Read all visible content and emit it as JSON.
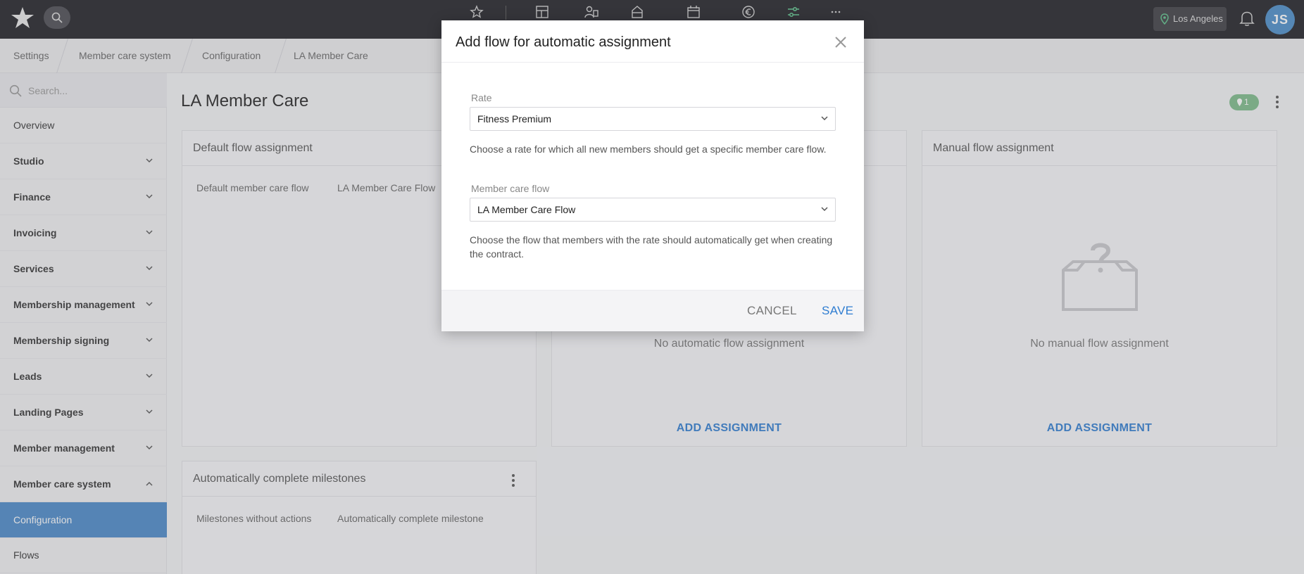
{
  "topbar": {
    "location": "Los Angeles",
    "avatar_initials": "JS",
    "nav_icons": [
      "star-icon",
      "dashboard-icon",
      "member-icon",
      "studio-icon",
      "calendar-icon",
      "euro-icon",
      "sliders-icon",
      "more-icon"
    ]
  },
  "breadcrumb": [
    "Settings",
    "Member care system",
    "Configuration",
    "LA Member Care"
  ],
  "sidebar": {
    "search_placeholder": "Search...",
    "items": [
      {
        "label": "Overview"
      },
      {
        "label": "Studio"
      },
      {
        "label": "Finance"
      },
      {
        "label": "Invoicing"
      },
      {
        "label": "Services"
      },
      {
        "label": "Membership management"
      },
      {
        "label": "Membership signing"
      },
      {
        "label": "Leads"
      },
      {
        "label": "Landing Pages"
      },
      {
        "label": "Member management"
      },
      {
        "label": "Member care system"
      },
      {
        "label": "Configuration"
      },
      {
        "label": "Flows"
      }
    ]
  },
  "main": {
    "title": "LA Member Care",
    "badge_count": "1",
    "cards": {
      "default": {
        "title": "Default flow assignment",
        "label": "Default member care flow",
        "value": "LA Member Care Flow"
      },
      "automatic": {
        "empty": "No automatic flow assignment",
        "action": "ADD ASSIGNMENT"
      },
      "manual": {
        "title": "Manual flow assignment",
        "empty": "No manual flow assignment",
        "action": "ADD ASSIGNMENT"
      },
      "milestones": {
        "title": "Automatically complete milestones",
        "label": "Milestones without actions",
        "value": "Automatically complete milestone"
      }
    }
  },
  "modal": {
    "title": "Add flow for automatic assignment",
    "rate_label": "Rate",
    "rate_value": "Fitness Premium",
    "rate_help": "Choose a rate for which all new members should get a specific member care flow.",
    "flow_label": "Member care flow",
    "flow_value": "LA Member Care Flow",
    "flow_help": "Choose the flow that members with the rate should automatically get when creating the contract.",
    "cancel": "CANCEL",
    "save": "SAVE"
  },
  "colors": {
    "accent": "#2f7dd1",
    "sidebar_active": "#4a88c8",
    "topbar": "#1f1f24",
    "badge": "#7dbb8a"
  }
}
